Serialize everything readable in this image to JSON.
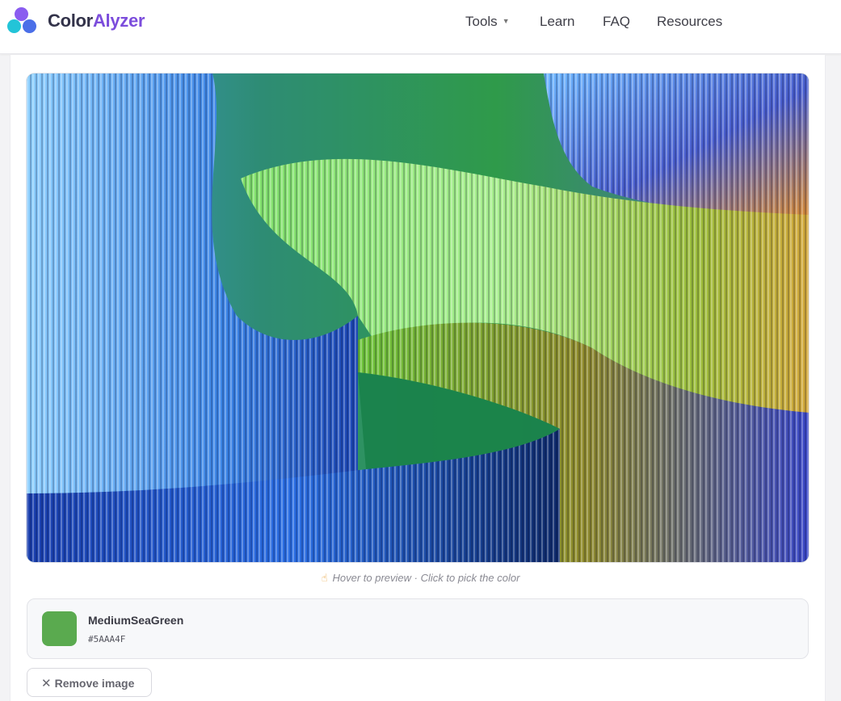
{
  "brand": {
    "part1": "Color",
    "part2": "Alyzer"
  },
  "nav": {
    "tools": "Tools",
    "learn": "Learn",
    "faq": "FAQ",
    "resources": "Resources"
  },
  "hint": {
    "text": "Hover to preview · Click to pick the color",
    "icon": "pointing-hand-icon"
  },
  "selected_color": {
    "name": "MediumSeaGreen",
    "hex": "#5AAA4F"
  },
  "remove_button": {
    "label": "Remove image",
    "icon": "close-icon"
  },
  "colors": {
    "brand_purple": "#7c4ddc",
    "logo_purple": "#8a5cf0",
    "logo_cyan": "#23c4d8",
    "logo_blue": "#4b6fe8"
  }
}
